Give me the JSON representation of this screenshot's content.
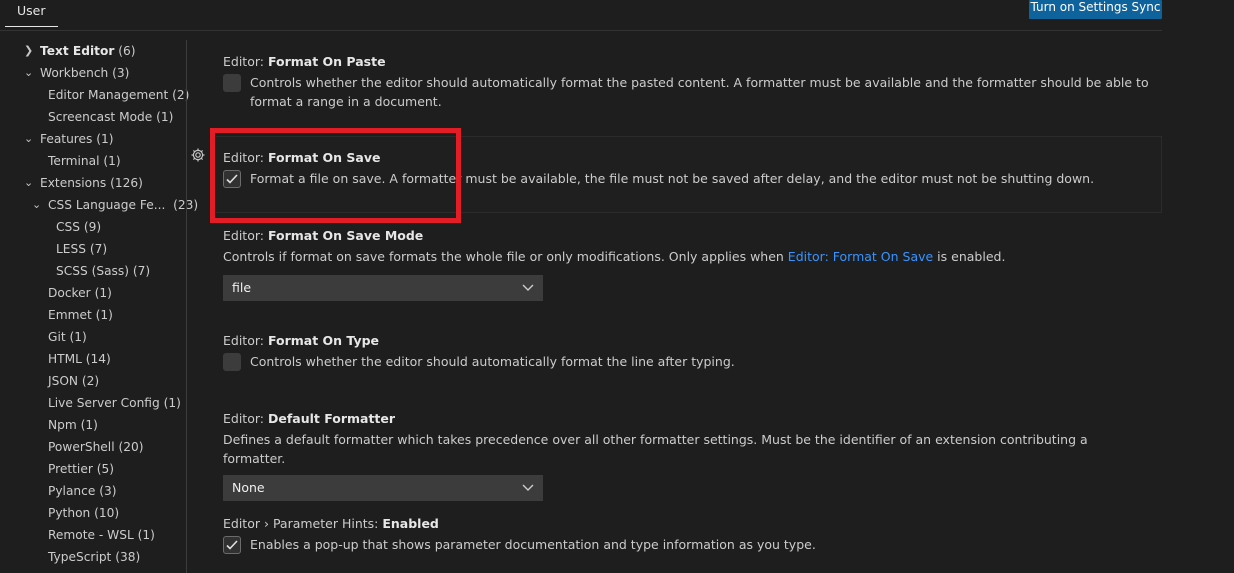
{
  "header": {
    "tab_user": "User",
    "sync_button": "Turn on Settings Sync"
  },
  "toc": {
    "items": [
      {
        "label": "Text Editor",
        "count": "(6)",
        "expanded": false,
        "bold": true
      },
      {
        "label": "Workbench",
        "count": "(3)",
        "expanded": true
      },
      {
        "label": "Editor Management",
        "count": "(2)"
      },
      {
        "label": "Screencast Mode",
        "count": "(1)"
      },
      {
        "label": "Features",
        "count": "(1)",
        "expanded": true
      },
      {
        "label": "Terminal",
        "count": "(1)"
      },
      {
        "label": "Extensions",
        "count": "(126)",
        "expanded": true
      },
      {
        "label": "CSS Language Fe...",
        "count": "(23)",
        "expanded": true
      },
      {
        "label": "CSS",
        "count": "(9)"
      },
      {
        "label": "LESS",
        "count": "(7)"
      },
      {
        "label": "SCSS (Sass)",
        "count": "(7)"
      },
      {
        "label": "Docker",
        "count": "(1)"
      },
      {
        "label": "Emmet",
        "count": "(1)"
      },
      {
        "label": "Git",
        "count": "(1)"
      },
      {
        "label": "HTML",
        "count": "(14)"
      },
      {
        "label": "JSON",
        "count": "(2)"
      },
      {
        "label": "Live Server Config",
        "count": "(1)"
      },
      {
        "label": "Npm",
        "count": "(1)"
      },
      {
        "label": "PowerShell",
        "count": "(20)"
      },
      {
        "label": "Prettier",
        "count": "(5)"
      },
      {
        "label": "Pylance",
        "count": "(3)"
      },
      {
        "label": "Python",
        "count": "(10)"
      },
      {
        "label": "Remote - WSL",
        "count": "(1)"
      },
      {
        "label": "TypeScript",
        "count": "(38)"
      }
    ]
  },
  "settings": {
    "format_on_paste": {
      "category": "Editor: ",
      "name": "Format On Paste",
      "description": "Controls whether the editor should automatically format the pasted content. A formatter must be available and the formatter should be able to format a range in a document.",
      "checked": false
    },
    "format_on_save": {
      "category": "Editor: ",
      "name": "Format On Save",
      "description": "Format a file on save. A formatter must be available, the file must not be saved after delay, and the editor must not be shutting down.",
      "checked": true
    },
    "format_on_save_mode": {
      "category": "Editor: ",
      "name": "Format On Save Mode",
      "description_pre": "Controls if format on save formats the whole file or only modifications. Only applies when ",
      "description_link": "Editor: Format On Save",
      "description_post": " is enabled.",
      "value": "file"
    },
    "format_on_type": {
      "category": "Editor: ",
      "name": "Format On Type",
      "description": "Controls whether the editor should automatically format the line after typing.",
      "checked": false
    },
    "default_formatter": {
      "category": "Editor: ",
      "name": "Default Formatter",
      "description": "Defines a default formatter which takes precedence over all other formatter settings. Must be the identifier of an extension contributing a formatter.",
      "value": "None"
    },
    "parameter_hints": {
      "category": "Editor › Parameter Hints: ",
      "name": "Enabled",
      "description": "Enables a pop-up that shows parameter documentation and type information as you type.",
      "checked": true
    }
  },
  "colors": {
    "background": "#1e1e1e",
    "accent_button": "#0e639c",
    "link": "#3794ff",
    "highlight": "#e21d25"
  }
}
